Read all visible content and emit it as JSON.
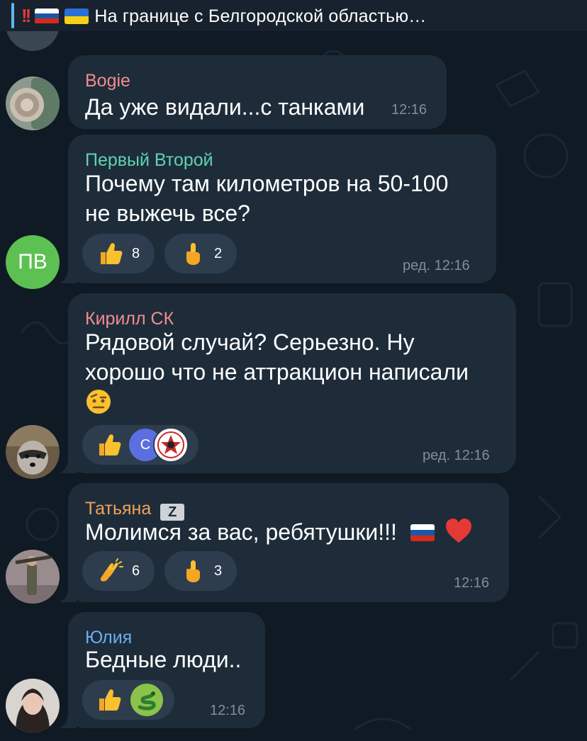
{
  "pinned": {
    "title": "На границе с Белгородской областью…",
    "exclaim": "!!"
  },
  "messages": [
    {
      "author": "Bogie",
      "author_color": "#f28c8c",
      "lines": [
        "Да уже видали...с танками"
      ],
      "time": "12:16"
    },
    {
      "author": "Первый Второй",
      "author_color": "#5fd3b1",
      "avatar_initials": "ПВ",
      "avatar_color": "#5cc152",
      "lines": [
        "Почему там километров на 50-100",
        "не выжечь  все?"
      ],
      "reactions": [
        {
          "icon": "thumbs-up-icon",
          "count": "8"
        },
        {
          "icon": "middle-finger-icon",
          "count": "2"
        }
      ],
      "time": "ред. 12:16"
    },
    {
      "author": "Кирилл СК",
      "author_color": "#f28c8c",
      "lines": [
        "Рядовой случай? Серьезно. Ну",
        "хорошо что не аттракцион написали"
      ],
      "trailing_emoji": "raised-eyebrow-face-icon",
      "reactions": [
        {
          "icon": "thumbs-up-icon",
          "avatars": [
            "С",
            "emblem-icon"
          ]
        }
      ],
      "time": "ред. 12:16"
    },
    {
      "author": "Татьяна",
      "author_color": "#f2a25b",
      "author_badge": "Z",
      "lines": [
        "Молимся за вас, ребятушки!!!"
      ],
      "trailing_emoji": "russian-flag-heart-icons",
      "reactions": [
        {
          "icon": "clapping-hands-icon",
          "count": "6"
        },
        {
          "icon": "middle-finger-icon",
          "count": "3"
        }
      ],
      "time": "12:16"
    },
    {
      "author": "Юлия",
      "author_color": "#6aaef2",
      "lines": [
        "Бедные люди.."
      ],
      "reactions": [
        {
          "icon": "thumbs-up-icon"
        },
        {
          "icon": "snake-icon"
        }
      ],
      "time": "12:16"
    }
  ],
  "colors": {
    "background": "#0f1a24",
    "bubble": "#1e2c3a",
    "reaction": "#2d3d4d",
    "accent": "#64b5ef"
  }
}
